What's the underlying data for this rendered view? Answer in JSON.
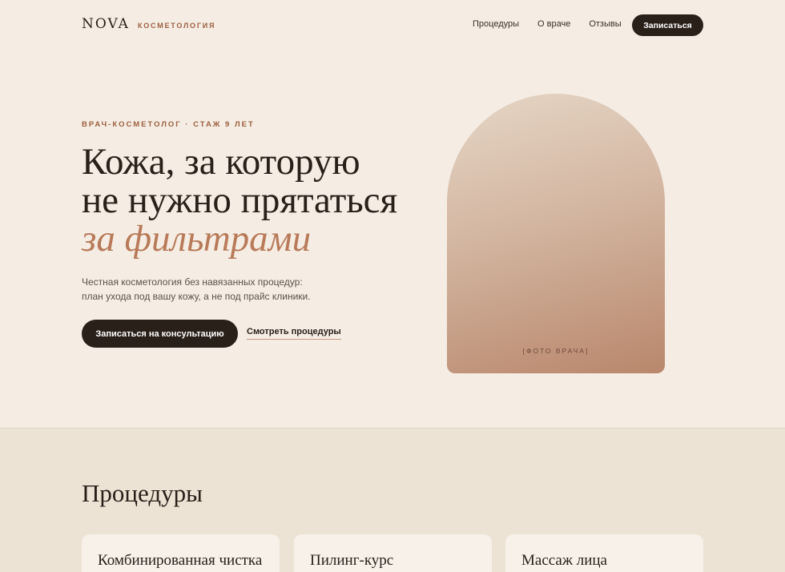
{
  "header": {
    "logo_mark": "NOVA",
    "logo_sub": "КОСМЕТОЛОГИЯ",
    "nav": [
      "Процедуры",
      "О враче",
      "Отзывы"
    ],
    "cta_label": "Записаться"
  },
  "hero": {
    "eyebrow": "ВРАЧ-КОСМЕТОЛОГ · СТАЖ 9 ЛЕТ",
    "headline_line1": "Кожа, за которую",
    "headline_line2": "не нужно прятаться",
    "headline_accent": "за фильтрами",
    "lede_line1": "Честная косметология без навязанных процедур:",
    "lede_line2": "план ухода под вашу кожу, а не под прайс клиники.",
    "primary_cta": "Записаться на консультацию",
    "secondary_link": "Смотреть процедуры",
    "photo_placeholder": "[ФОТО ВРАЧА]"
  },
  "procedures": {
    "title": "Процедуры",
    "cards": [
      {
        "title": "Комбинированная чистка"
      },
      {
        "title": "Пилинг-курс"
      },
      {
        "title": "Массаж лица"
      }
    ]
  },
  "colors": {
    "background": "#f5ede4",
    "section_background": "#ede3d5",
    "dark": "#2a201a",
    "accent": "#b87a58",
    "eyebrow": "#9c5f3f"
  }
}
